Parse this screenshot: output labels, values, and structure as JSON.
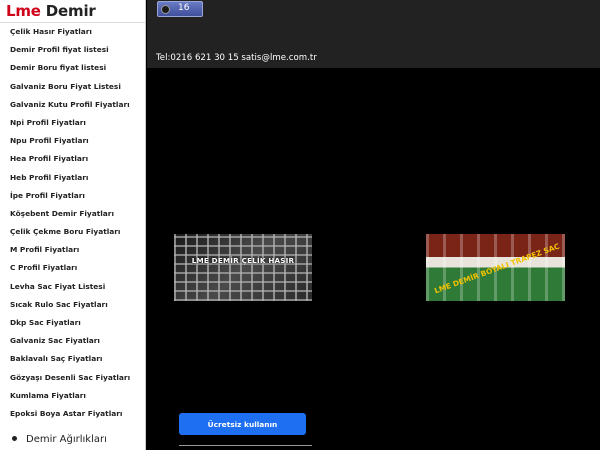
{
  "brand": {
    "part1": "Lme",
    "part2": "Demir"
  },
  "sidebar": {
    "items": [
      "Çelik Hasır Fiyatları",
      "Demir Profil fiyat listesi",
      "Demir Boru fiyat listesi",
      "Galvaniz Boru Fiyat Listesi",
      "Galvaniz Kutu Profil Fiyatları",
      "Npi Profil Fiyatları",
      "Npu Profil Fiyatları",
      "Hea Profil Fiyatları",
      "Heb Profil Fiyatları",
      "İpe Profil Fiyatları",
      "Köşebent Demir Fiyatları",
      "Çelik Çekme Boru Fiyatları",
      "M Profil Fiyatları",
      "C Profil Fiyatları",
      "Levha Sac Fiyat Listesi",
      "Sıcak Rulo Sac Fiyatları",
      "Dkp Sac Fiyatları",
      "Galvaniz Sac Fiyatları",
      "Baklavalı Saç Fiyatları",
      "Gözyaşı Desenli Sac Fiyatları",
      "Kumlama Fiyatları",
      "Epoksi Boya Astar Fiyatları"
    ],
    "bullet_item": "Demir Ağırlıkları"
  },
  "header": {
    "counter_value": "16",
    "contact": "Tel:0216 621 30 15 satis@lme.com.tr"
  },
  "images": {
    "mesh_caption": "LME DEMİR ÇELİK HASIR",
    "trapez_caption": "LME DEMİR BOYALI TRAPEZ SAC"
  },
  "cta": {
    "label": "Ücretsiz kullanın"
  },
  "colors": {
    "brand_red": "#d0021b",
    "cta_blue": "#1e6ff1",
    "header_bg": "#222222"
  }
}
